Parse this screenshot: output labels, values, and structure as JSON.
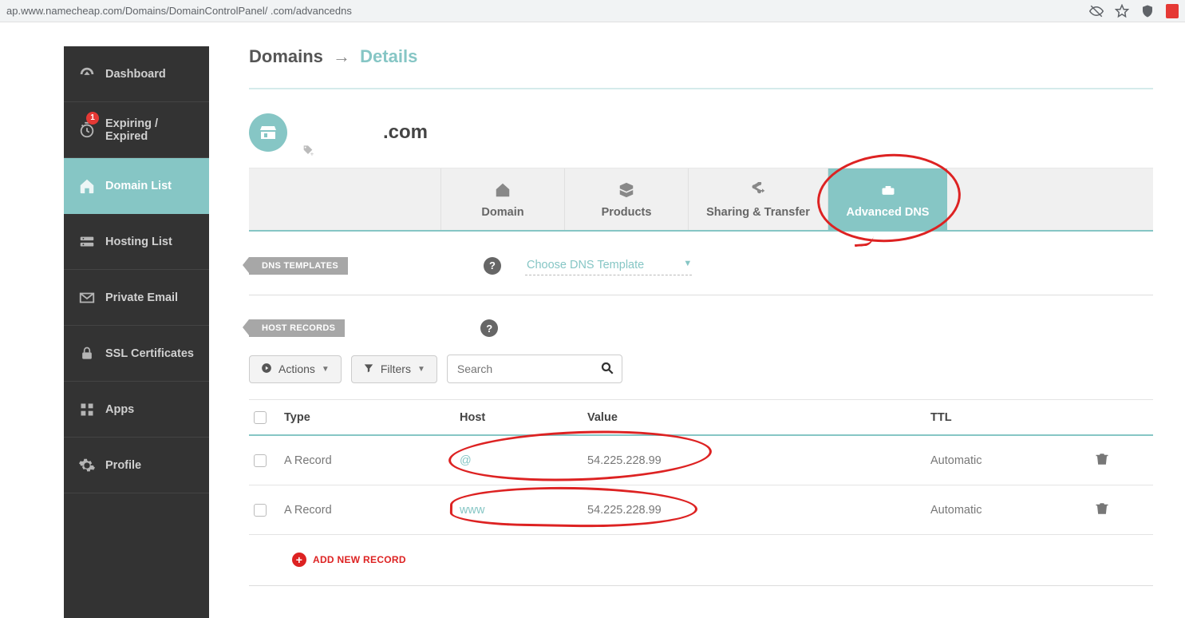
{
  "browser": {
    "url": "ap.www.namecheap.com/Domains/DomainControlPanel/                       .com/advancedns"
  },
  "sidebar": {
    "items": [
      {
        "label": "Dashboard"
      },
      {
        "label": "Expiring / Expired",
        "badge": "1"
      },
      {
        "label": "Domain List"
      },
      {
        "label": "Hosting List"
      },
      {
        "label": "Private Email"
      },
      {
        "label": "SSL Certificates"
      },
      {
        "label": "Apps"
      },
      {
        "label": "Profile"
      }
    ]
  },
  "breadcrumb": {
    "root": "Domains",
    "arrow": "→",
    "current": "Details"
  },
  "domain": {
    "name": ".com"
  },
  "tabs": [
    {
      "label": "Domain"
    },
    {
      "label": "Products"
    },
    {
      "label": "Sharing & Transfer"
    },
    {
      "label": "Advanced DNS"
    }
  ],
  "sections": {
    "dns_templates_label": "DNS TEMPLATES",
    "dns_template_placeholder": "Choose DNS Template",
    "host_records_label": "HOST RECORDS"
  },
  "buttons": {
    "actions": "Actions",
    "filters": "Filters",
    "search_placeholder": "Search",
    "add_record": "ADD NEW RECORD"
  },
  "table": {
    "headers": {
      "type": "Type",
      "host": "Host",
      "value": "Value",
      "ttl": "TTL"
    },
    "rows": [
      {
        "type": "A Record",
        "host": "@",
        "value": "54.225.228.99",
        "ttl": "Automatic"
      },
      {
        "type": "A Record",
        "host": "www",
        "value": "54.225.228.99",
        "ttl": "Automatic"
      }
    ]
  }
}
